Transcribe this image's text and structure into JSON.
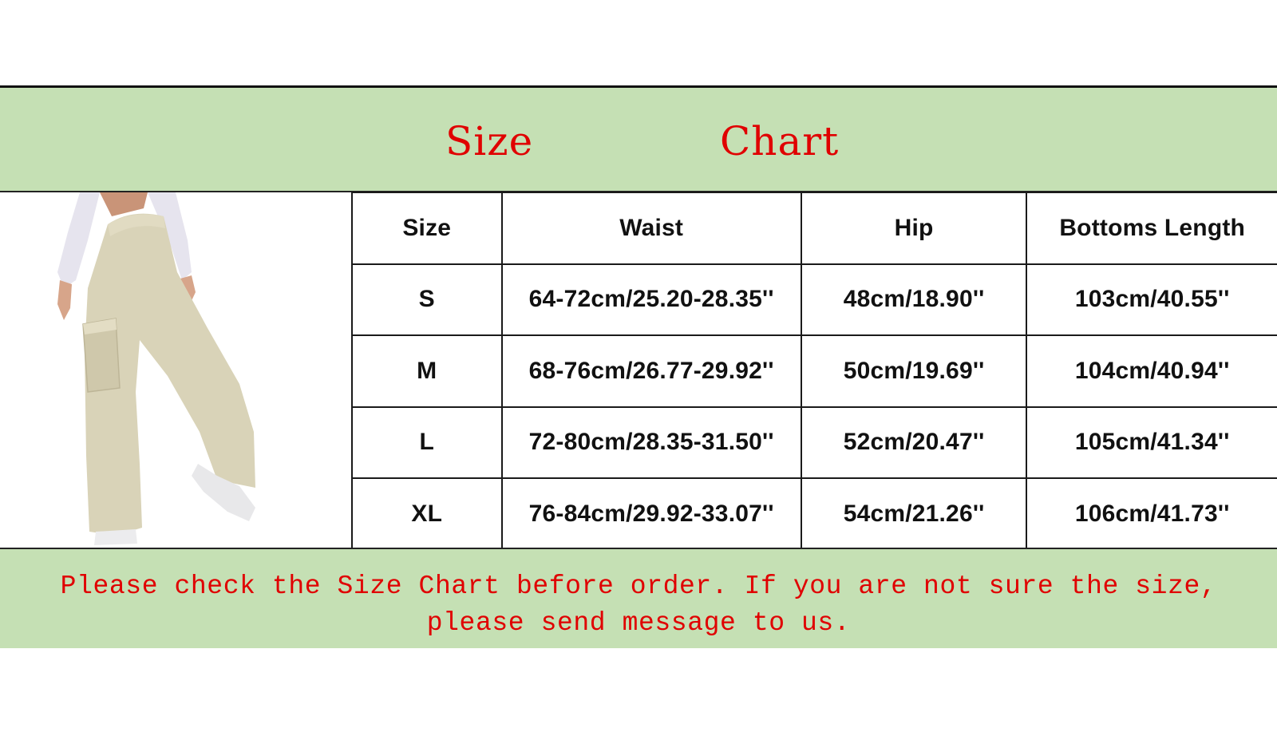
{
  "title": {
    "word1": "Size",
    "word2": "Chart"
  },
  "colors": {
    "band_background": "#c5e0b4",
    "title_text": "#e00000",
    "note_text": "#e00000",
    "table_text": "#111111",
    "product_color": "#d9d3b8"
  },
  "product_image": {
    "description": "khaki wide-leg cargo pants",
    "icon": "product-photo"
  },
  "table": {
    "headers": [
      "Size",
      "Waist",
      "Hip",
      "Bottoms Length"
    ],
    "rows": [
      {
        "size": "S",
        "waist": "64-72cm/25.20-28.35''",
        "hip": "48cm/18.90''",
        "length": "103cm/40.55''"
      },
      {
        "size": "M",
        "waist": "68-76cm/26.77-29.92''",
        "hip": "50cm/19.69''",
        "length": "104cm/40.94''"
      },
      {
        "size": "L",
        "waist": "72-80cm/28.35-31.50''",
        "hip": "52cm/20.47''",
        "length": "105cm/41.34''"
      },
      {
        "size": "XL",
        "waist": "76-84cm/29.92-33.07''",
        "hip": "54cm/21.26''",
        "length": "106cm/41.73''"
      }
    ]
  },
  "note": {
    "text": "Please check the Size Chart before order. If you are not sure the size, please send message to us."
  }
}
